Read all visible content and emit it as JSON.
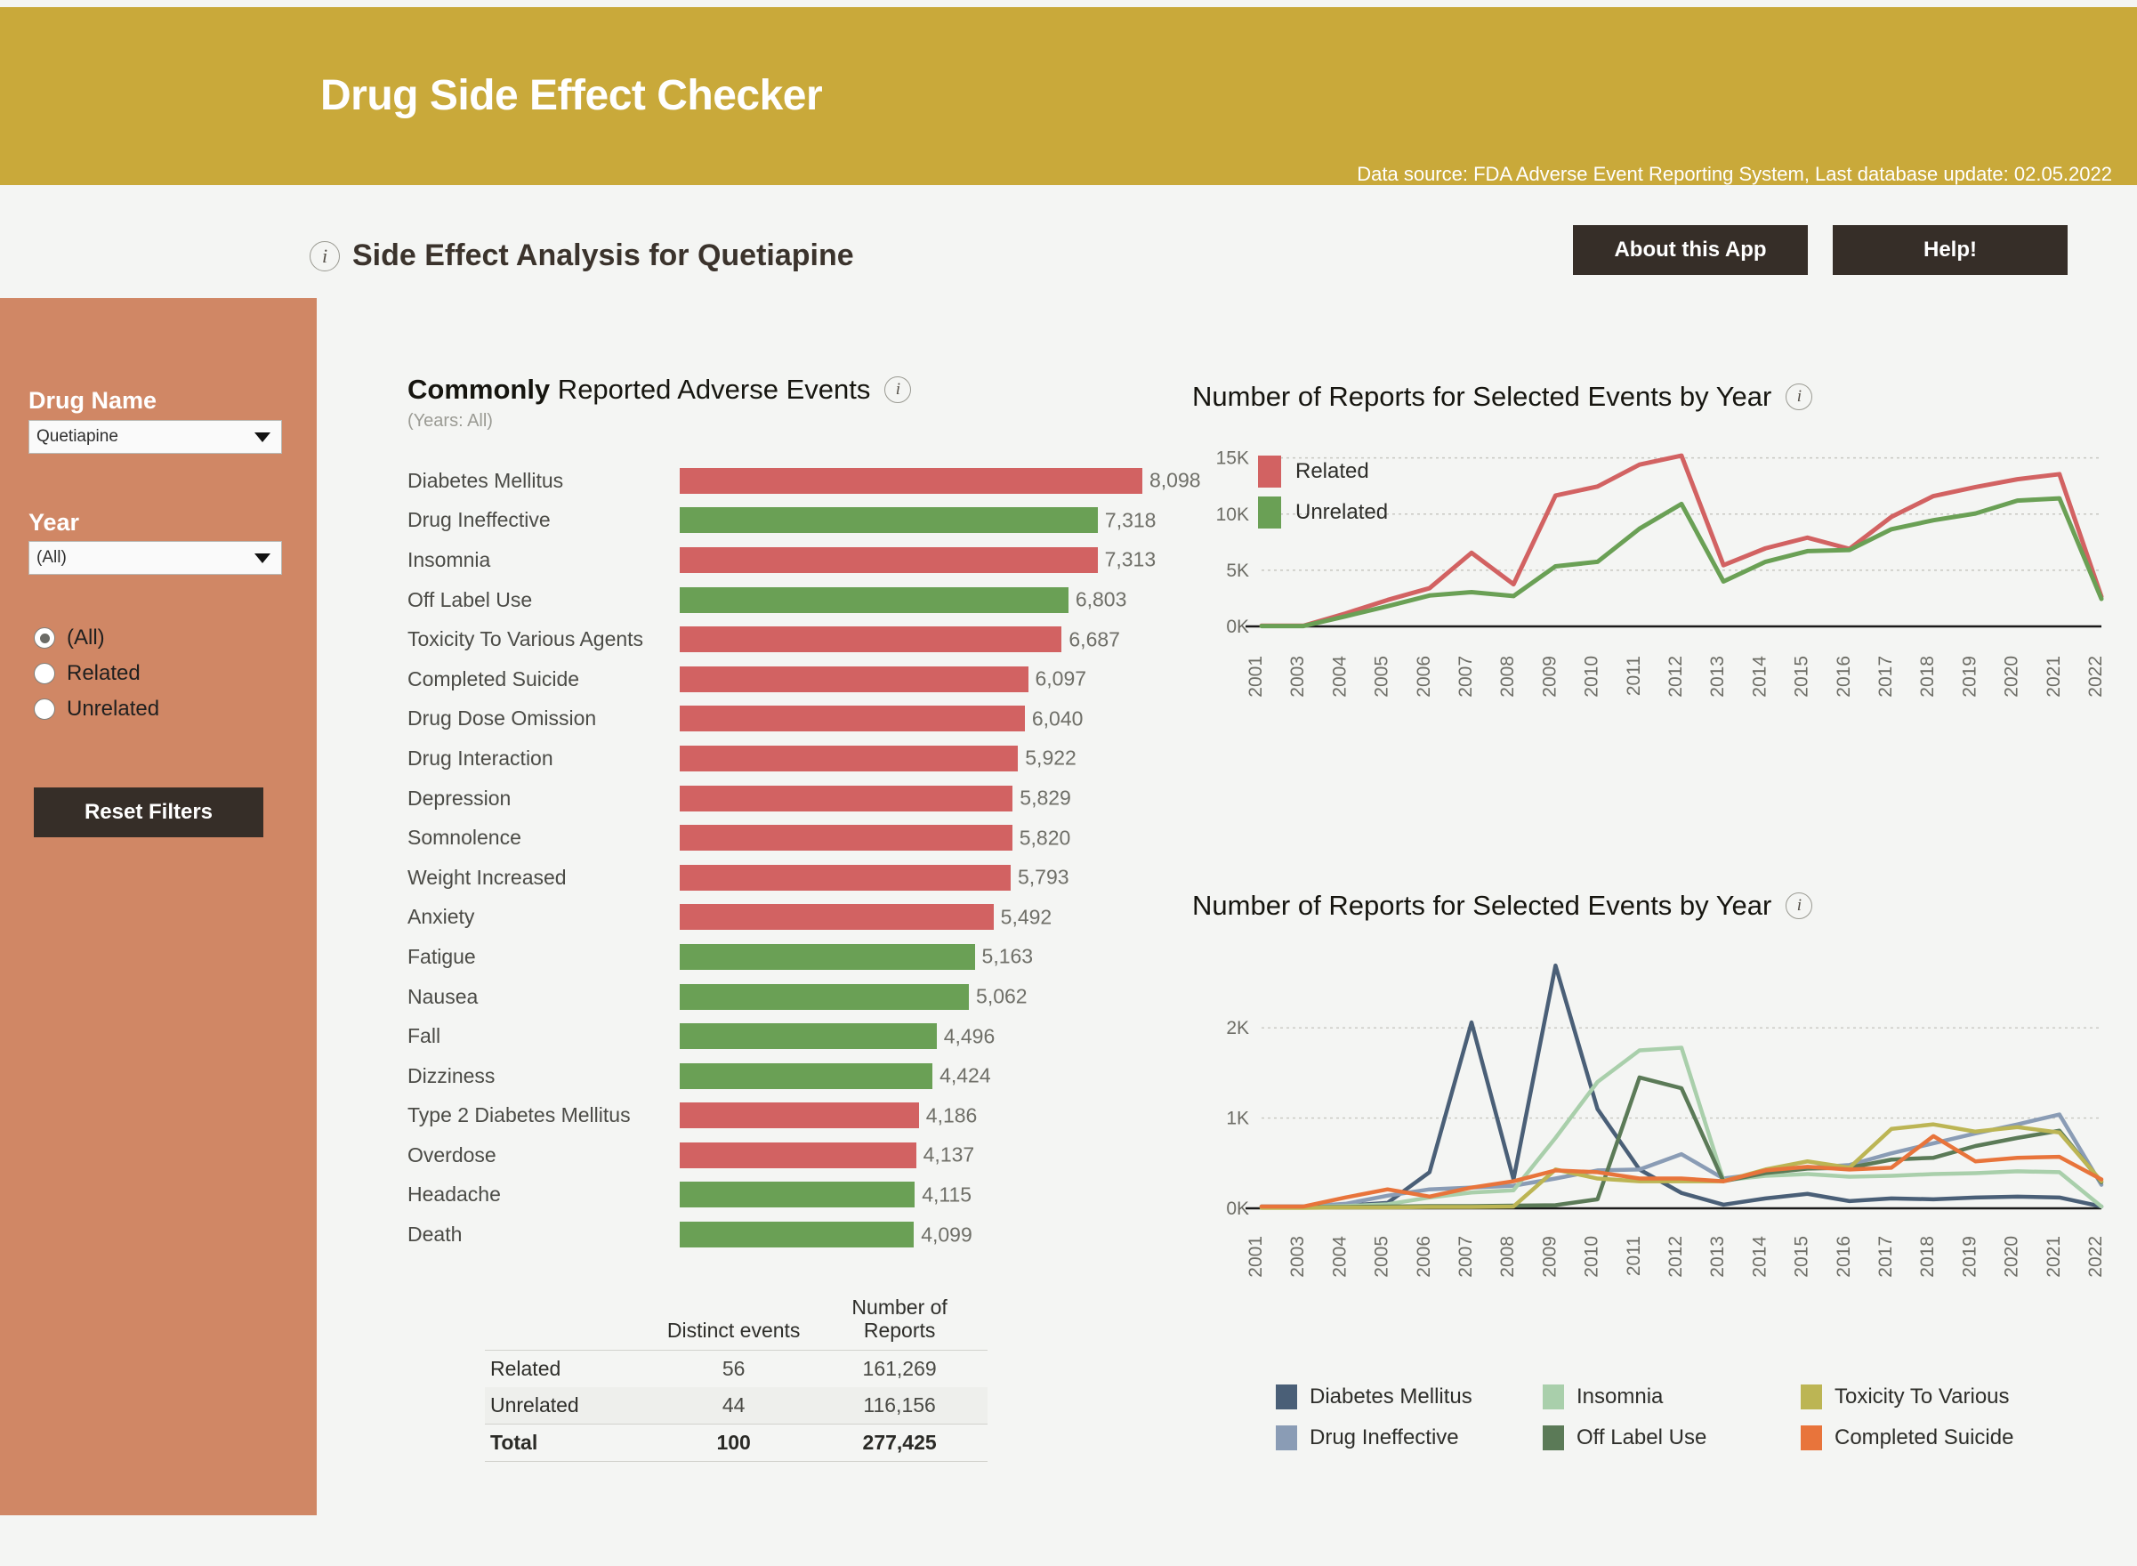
{
  "header": {
    "title": "Drug Side Effect Checker",
    "data_source": "Data source: FDA Adverse Event Reporting System, Last database update: 02.05.2022",
    "brand_color": "#c9a93a"
  },
  "subheader": {
    "info_icon": "info-icon",
    "page_title": "Side Effect Analysis for Quetiapine",
    "about_button": "About this App",
    "help_button": "Help!"
  },
  "sidebar": {
    "background_color": "#d08765",
    "drug_name_label": "Drug Name",
    "drug_name_value": "Quetiapine",
    "year_label": "Year",
    "year_value": "(All)",
    "radio_options": [
      "(All)",
      "Related",
      "Unrelated"
    ],
    "radio_selected": "(All)",
    "reset_button": "Reset Filters"
  },
  "bar_panel": {
    "title_bold": "Commonly",
    "title_rest": " Reported Adverse Events",
    "subtitle": "(Years: All)",
    "info_icon": "info-icon"
  },
  "summary_table": {
    "columns": [
      "",
      "Distinct events",
      "Number of Reports"
    ],
    "rows": [
      {
        "name": "Related",
        "distinct": "56",
        "reports": "161,269"
      },
      {
        "name": "Unrelated",
        "distinct": "44",
        "reports": "116,156"
      },
      {
        "name": "Total",
        "distinct": "100",
        "reports": "277,425"
      }
    ]
  },
  "chart_data": [
    {
      "type": "bar",
      "title": "Commonly Reported Adverse Events",
      "subtitle": "(Years: All)",
      "orientation": "horizontal",
      "xlabel": "",
      "ylabel": "",
      "xlim": [
        0,
        8098
      ],
      "grid": false,
      "legend": "none",
      "colors": {
        "Related": "#d26262",
        "Unrelated": "#6aa055"
      },
      "categories": [
        "Diabetes Mellitus",
        "Drug Ineffective",
        "Insomnia",
        "Off Label Use",
        "Toxicity To Various Agents",
        "Completed Suicide",
        "Drug Dose Omission",
        "Drug Interaction",
        "Depression",
        "Somnolence",
        "Weight Increased",
        "Anxiety",
        "Fatigue",
        "Nausea",
        "Fall",
        "Dizziness",
        "Type 2 Diabetes Mellitus",
        "Overdose",
        "Headache",
        "Death"
      ],
      "values": [
        8098,
        7318,
        7313,
        6803,
        6687,
        6097,
        6040,
        5922,
        5829,
        5820,
        5793,
        5492,
        5163,
        5062,
        4496,
        4424,
        4186,
        4137,
        4115,
        4099
      ],
      "value_labels": [
        "8,098",
        "7,318",
        "7,313",
        "6,803",
        "6,687",
        "6,097",
        "6,040",
        "5,922",
        "5,829",
        "5,820",
        "5,793",
        "5,492",
        "5,163",
        "5,062",
        "4,496",
        "4,424",
        "4,186",
        "4,137",
        "4,115",
        "4,099"
      ],
      "groups": [
        "Related",
        "Unrelated",
        "Related",
        "Unrelated",
        "Related",
        "Related",
        "Related",
        "Related",
        "Related",
        "Related",
        "Related",
        "Related",
        "Unrelated",
        "Unrelated",
        "Unrelated",
        "Unrelated",
        "Related",
        "Related",
        "Unrelated",
        "Unrelated"
      ]
    },
    {
      "type": "line",
      "title": "Number of Reports for Selected Events by Year",
      "xlabel": "",
      "ylabel": "",
      "ylim": [
        0,
        16000
      ],
      "yticks": [
        0,
        5000,
        10000,
        15000
      ],
      "ytick_labels": [
        "0K",
        "5K",
        "10K",
        "15K"
      ],
      "grid": true,
      "legend_position": "top-left",
      "x": [
        "2001",
        "2003",
        "2004",
        "2005",
        "2006",
        "2007",
        "2008",
        "2009",
        "2010",
        "2011",
        "2012",
        "2013",
        "2014",
        "2015",
        "2016",
        "2017",
        "2018",
        "2019",
        "2020",
        "2021",
        "2022"
      ],
      "series": [
        {
          "name": "Related",
          "color": "#d26262",
          "values": [
            60,
            60,
            1150,
            2350,
            3400,
            6550,
            3750,
            11650,
            12450,
            14400,
            15200,
            5450,
            6950,
            7900,
            6900,
            9750,
            11600,
            12400,
            13100,
            13550,
            2650
          ]
        },
        {
          "name": "Unrelated",
          "color": "#6aa055",
          "values": [
            30,
            30,
            900,
            1800,
            2750,
            3050,
            2700,
            5350,
            5750,
            8700,
            10900,
            4000,
            5750,
            6700,
            6800,
            8650,
            9450,
            10050,
            11200,
            11400,
            2450
          ]
        }
      ]
    },
    {
      "type": "line",
      "title": "Number of Reports for Selected Events by Year",
      "xlabel": "",
      "ylabel": "",
      "ylim": [
        0,
        2800
      ],
      "yticks": [
        0,
        1000,
        2000
      ],
      "ytick_labels": [
        "0K",
        "1K",
        "2K"
      ],
      "grid": true,
      "legend_position": "bottom",
      "x": [
        "2001",
        "2003",
        "2004",
        "2005",
        "2006",
        "2007",
        "2008",
        "2009",
        "2010",
        "2011",
        "2012",
        "2013",
        "2014",
        "2015",
        "2016",
        "2017",
        "2018",
        "2019",
        "2020",
        "2021",
        "2022"
      ],
      "series": [
        {
          "name": "Diabetes Mellitus",
          "color": "#4a5f77",
          "values": [
            20,
            20,
            30,
            60,
            400,
            2060,
            320,
            2690,
            1100,
            430,
            170,
            40,
            110,
            160,
            80,
            110,
            100,
            120,
            130,
            120,
            20
          ]
        },
        {
          "name": "Drug Ineffective",
          "color": "#8a9cb5",
          "values": [
            20,
            20,
            50,
            140,
            210,
            230,
            250,
            330,
            420,
            430,
            600,
            330,
            390,
            450,
            480,
            610,
            720,
            830,
            930,
            1040,
            260
          ]
        },
        {
          "name": "Insomnia",
          "color": "#a9cfab",
          "values": [
            15,
            15,
            25,
            45,
            120,
            175,
            200,
            780,
            1400,
            1750,
            1780,
            310,
            360,
            380,
            350,
            360,
            380,
            390,
            410,
            400,
            20
          ]
        },
        {
          "name": "Off Label Use",
          "color": "#5b7a57",
          "values": [
            10,
            10,
            15,
            20,
            25,
            25,
            30,
            35,
            100,
            1450,
            1330,
            300,
            390,
            440,
            450,
            540,
            560,
            690,
            780,
            860,
            290
          ]
        },
        {
          "name": "Toxicity To Various",
          "color": "#bcb554",
          "values": [
            5,
            5,
            10,
            10,
            15,
            15,
            20,
            430,
            330,
            300,
            300,
            300,
            430,
            520,
            450,
            880,
            930,
            850,
            900,
            840,
            300
          ]
        },
        {
          "name": "Completed Suicide",
          "color": "#e8743b",
          "values": [
            20,
            20,
            120,
            210,
            130,
            230,
            300,
            420,
            400,
            330,
            330,
            300,
            420,
            460,
            430,
            450,
            800,
            520,
            560,
            570,
            320
          ]
        }
      ]
    }
  ]
}
